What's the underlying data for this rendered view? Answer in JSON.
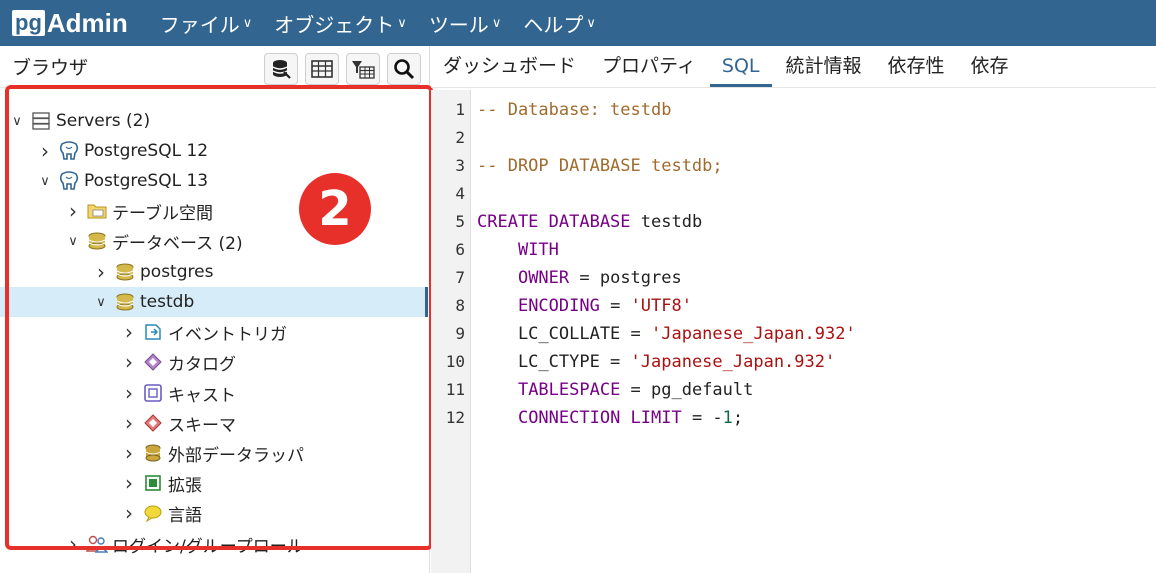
{
  "app": {
    "logo_pg": "pg",
    "logo_admin": "Admin"
  },
  "menu": [
    {
      "label": "ファイル"
    },
    {
      "label": "オブジェクト"
    },
    {
      "label": "ツール"
    },
    {
      "label": "ヘルプ"
    }
  ],
  "browser": {
    "title": "ブラウザ",
    "toolbar_icons": [
      "database-query-icon",
      "table-icon",
      "filter-table-icon",
      "search-icon"
    ]
  },
  "tree": [
    {
      "label": "Servers (2)",
      "depth": 0,
      "expanded": true,
      "icon": "servers-icon"
    },
    {
      "label": "PostgreSQL 12",
      "depth": 1,
      "expanded": false,
      "icon": "postgres-elephant-icon"
    },
    {
      "label": "PostgreSQL 13",
      "depth": 1,
      "expanded": true,
      "icon": "postgres-elephant-icon"
    },
    {
      "label": "テーブル空間",
      "depth": 2,
      "expanded": false,
      "icon": "tablespace-folder-icon"
    },
    {
      "label": "データベース (2)",
      "depth": 2,
      "expanded": true,
      "icon": "databases-icon"
    },
    {
      "label": "postgres",
      "depth": 3,
      "expanded": false,
      "icon": "database-icon"
    },
    {
      "label": "testdb",
      "depth": 3,
      "expanded": true,
      "icon": "database-icon",
      "selected": true
    },
    {
      "label": "イベントトリガ",
      "depth": 4,
      "expanded": false,
      "icon": "event-trigger-icon"
    },
    {
      "label": "カタログ",
      "depth": 4,
      "expanded": false,
      "icon": "catalog-icon"
    },
    {
      "label": "キャスト",
      "depth": 4,
      "expanded": false,
      "icon": "cast-icon"
    },
    {
      "label": "スキーマ",
      "depth": 4,
      "expanded": false,
      "icon": "schema-icon"
    },
    {
      "label": "外部データラッパ",
      "depth": 4,
      "expanded": false,
      "icon": "foreign-data-wrapper-icon"
    },
    {
      "label": "拡張",
      "depth": 4,
      "expanded": false,
      "icon": "extension-icon"
    },
    {
      "label": "言語",
      "depth": 4,
      "expanded": false,
      "icon": "language-icon"
    },
    {
      "label": "ログイン/グループロール",
      "depth": 2,
      "expanded": false,
      "icon": "login-group-roles-icon"
    }
  ],
  "annotation": {
    "number": "2",
    "color": "#e8302a"
  },
  "tabs": [
    {
      "label": "ダッシュボード"
    },
    {
      "label": "プロパティ"
    },
    {
      "label": "SQL",
      "active": true
    },
    {
      "label": "統計情報"
    },
    {
      "label": "依存性"
    },
    {
      "label": "依存"
    }
  ],
  "sql_lines": [
    [
      {
        "t": "-- Database: testdb",
        "c": "cm"
      }
    ],
    [],
    [
      {
        "t": "-- DROP DATABASE testdb;",
        "c": "cm"
      }
    ],
    [],
    [
      {
        "t": "CREATE DATABASE",
        "c": "kw"
      },
      {
        "t": " testdb",
        "c": "plain"
      }
    ],
    [
      {
        "t": "    ",
        "c": "plain"
      },
      {
        "t": "WITH",
        "c": "kw"
      }
    ],
    [
      {
        "t": "    ",
        "c": "plain"
      },
      {
        "t": "OWNER",
        "c": "kw"
      },
      {
        "t": " = postgres",
        "c": "plain"
      }
    ],
    [
      {
        "t": "    ",
        "c": "plain"
      },
      {
        "t": "ENCODING",
        "c": "kw"
      },
      {
        "t": " = ",
        "c": "plain"
      },
      {
        "t": "'UTF8'",
        "c": "str"
      }
    ],
    [
      {
        "t": "    LC_COLLATE = ",
        "c": "plain"
      },
      {
        "t": "'Japanese_Japan.932'",
        "c": "str"
      }
    ],
    [
      {
        "t": "    LC_CTYPE = ",
        "c": "plain"
      },
      {
        "t": "'Japanese_Japan.932'",
        "c": "str"
      }
    ],
    [
      {
        "t": "    ",
        "c": "plain"
      },
      {
        "t": "TABLESPACE",
        "c": "kw"
      },
      {
        "t": " = pg_default",
        "c": "plain"
      }
    ],
    [
      {
        "t": "    ",
        "c": "plain"
      },
      {
        "t": "CONNECTION LIMIT",
        "c": "kw"
      },
      {
        "t": " = -",
        "c": "plain"
      },
      {
        "t": "1",
        "c": "num"
      },
      {
        "t": ";",
        "c": "plain"
      }
    ]
  ],
  "line_numbers": [
    "1",
    "2",
    "3",
    "4",
    "5",
    "6",
    "7",
    "8",
    "9",
    "10",
    "11",
    "12"
  ],
  "colors": {
    "navbar": "#326690",
    "selected_row": "#d6ecf8",
    "annotation_red": "#e8302a"
  }
}
